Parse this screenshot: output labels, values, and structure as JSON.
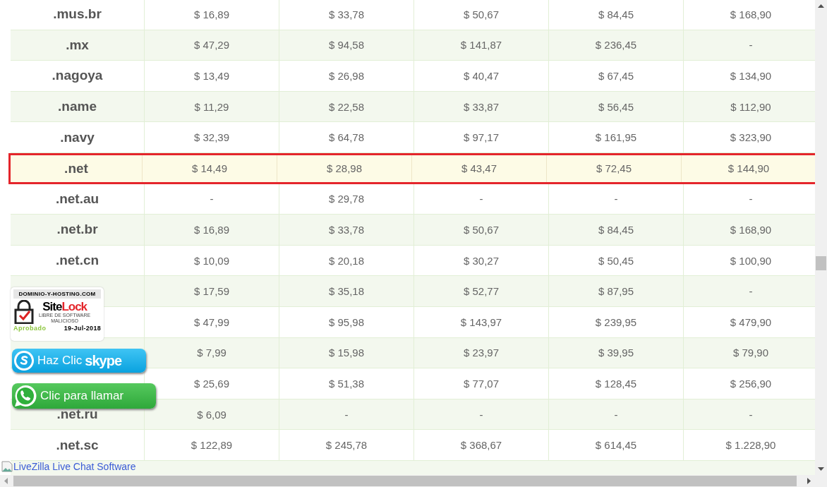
{
  "table": {
    "rows": [
      {
        "domain": ".mus.br",
        "selected": false,
        "prices": [
          "$ 16,89",
          "$ 33,78",
          "$ 50,67",
          "$ 84,45",
          "$ 168,90"
        ]
      },
      {
        "domain": ".mx",
        "selected": false,
        "prices": [
          "$ 47,29",
          "$ 94,58",
          "$ 141,87",
          "$ 236,45",
          "-"
        ]
      },
      {
        "domain": ".nagoya",
        "selected": false,
        "prices": [
          "$ 13,49",
          "$ 26,98",
          "$ 40,47",
          "$ 67,45",
          "$ 134,90"
        ]
      },
      {
        "domain": ".name",
        "selected": false,
        "prices": [
          "$ 11,29",
          "$ 22,58",
          "$ 33,87",
          "$ 56,45",
          "$ 112,90"
        ]
      },
      {
        "domain": ".navy",
        "selected": false,
        "prices": [
          "$ 32,39",
          "$ 64,78",
          "$ 97,17",
          "$ 161,95",
          "$ 323,90"
        ]
      },
      {
        "domain": ".net",
        "selected": true,
        "prices": [
          "$ 14,49",
          "$ 28,98",
          "$ 43,47",
          "$ 72,45",
          "$ 144,90"
        ]
      },
      {
        "domain": ".net.au",
        "selected": false,
        "prices": [
          "-",
          "$ 29,78",
          "-",
          "-",
          "-"
        ]
      },
      {
        "domain": ".net.br",
        "selected": false,
        "prices": [
          "$ 16,89",
          "$ 33,78",
          "$ 50,67",
          "$ 84,45",
          "$ 168,90"
        ]
      },
      {
        "domain": ".net.cn",
        "selected": false,
        "prices": [
          "$ 10,09",
          "$ 20,18",
          "$ 30,27",
          "$ 50,45",
          "$ 100,90"
        ]
      },
      {
        "selected": false,
        "prices": [
          "$ 17,59",
          "$ 35,18",
          "$ 52,77",
          "$ 87,95",
          "-"
        ]
      },
      {
        "selected": false,
        "prices": [
          "$ 47,99",
          "$ 95,98",
          "$ 143,97",
          "$ 239,95",
          "$ 479,90"
        ]
      },
      {
        "selected": false,
        "prices": [
          "$ 7,99",
          "$ 15,98",
          "$ 23,97",
          "$ 39,95",
          "$ 79,90"
        ]
      },
      {
        "selected": false,
        "prices": [
          "$ 25,69",
          "$ 51,38",
          "$ 77,07",
          "$ 128,45",
          "$ 256,90"
        ]
      },
      {
        "domain": ".net.ru",
        "selected": false,
        "prices": [
          "$ 6,09",
          "-",
          "-",
          "-",
          "-"
        ]
      },
      {
        "domain": ".net.sc",
        "selected": false,
        "prices": [
          "$ 122,89",
          "$ 245,78",
          "$ 368,67",
          "$ 614,45",
          "$ 1.228,90"
        ]
      }
    ]
  },
  "sitelock": {
    "site": "DOMINIO-Y-HOSTING.COM",
    "brand_first": "Site",
    "brand_second": "Lock",
    "line1": "LIBRE DE SOFTWARE",
    "line2": "MALICIOSO",
    "status": "Aprobado",
    "date": "19-Jul-2018"
  },
  "skype_button": {
    "label": "Haz Clic",
    "brand": "skype"
  },
  "whatsapp_button": {
    "label": "Clic para llamar"
  },
  "chat_link": {
    "text": "LiveZilla Live Chat Software"
  }
}
